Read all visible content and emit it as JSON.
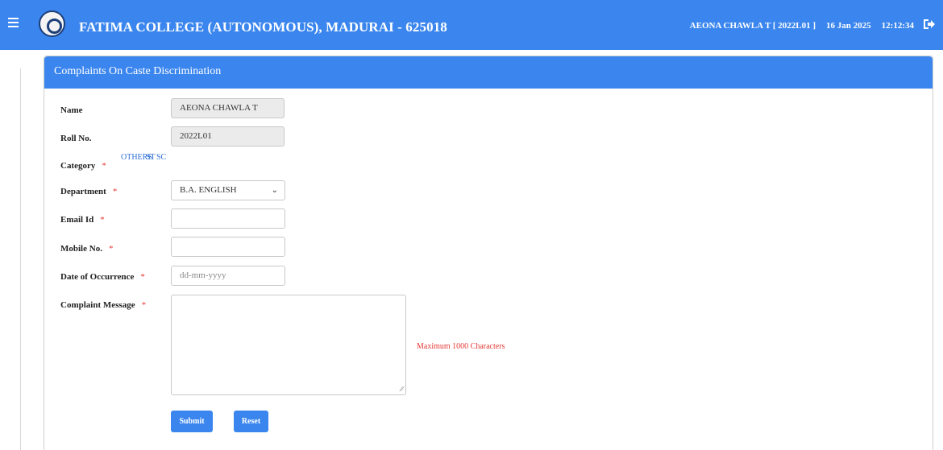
{
  "header": {
    "college_name": "FATIMA COLLEGE (AUTONOMOUS), MADURAI - 625018",
    "user": "AEONA CHAWLA T [ 2022L01 ]",
    "date": "16 Jan 2025",
    "time": "12:12:34"
  },
  "card": {
    "title": "Complaints On Caste Discrimination"
  },
  "form": {
    "name_label": "Name",
    "name_value": "AEONA CHAWLA T",
    "roll_label": "Roll No.",
    "roll_value": "2022L01",
    "category_label": "Category",
    "category_options": [
      "OTHERS",
      "ST",
      "SC"
    ],
    "department_label": "Department",
    "department_value": "B.A. ENGLISH",
    "email_label": "Email Id",
    "email_value": "",
    "mobile_label": "Mobile No.",
    "mobile_value": "",
    "date_label": "Date of Occurrence",
    "date_placeholder": "dd-mm-yyyy",
    "message_label": "Complaint Message",
    "message_note": "Maximum 1000 Characters",
    "required_mark": "*",
    "submit_label": "Submit",
    "reset_label": "Reset"
  }
}
